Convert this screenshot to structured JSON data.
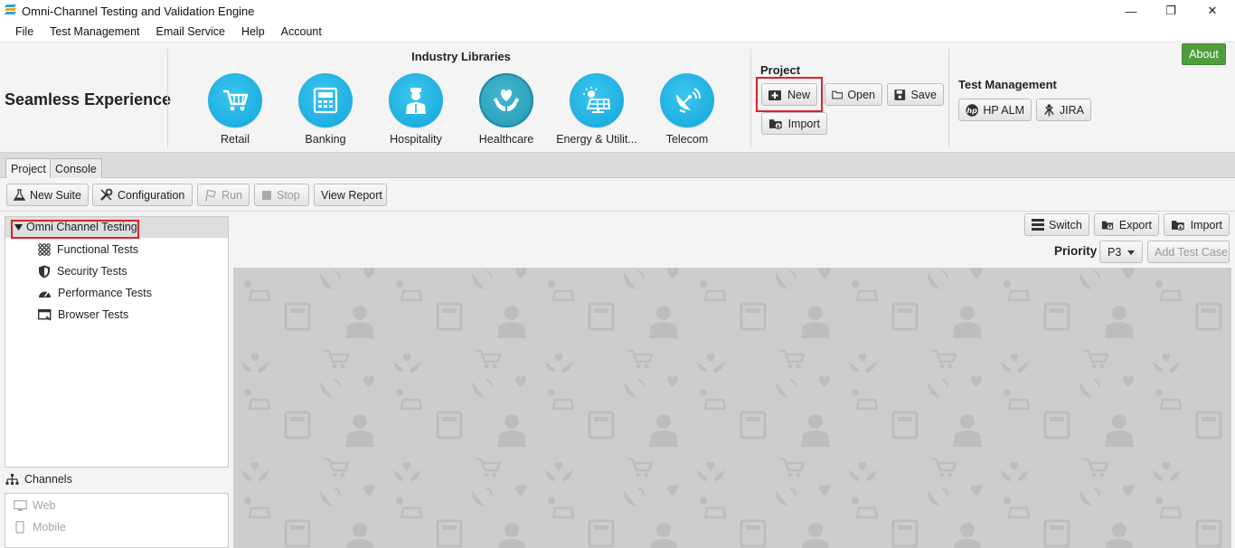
{
  "window": {
    "title": "Omni-Channel Testing and Validation Engine",
    "minimize_glyph": "—",
    "maximize_glyph": "❐",
    "close_glyph": "✕"
  },
  "menu": [
    "File",
    "Test Management",
    "Email Service",
    "Help",
    "Account"
  ],
  "ribbon": {
    "brand": "Seamless Experience",
    "libraries_title": "Industry Libraries",
    "libraries": [
      {
        "label": "Retail",
        "icon": "cart-icon"
      },
      {
        "label": "Banking",
        "icon": "atm-icon"
      },
      {
        "label": "Hospitality",
        "icon": "bellhop-icon"
      },
      {
        "label": "Healthcare",
        "icon": "heart-hands-icon"
      },
      {
        "label": "Energy & Utilit...",
        "icon": "solar-panel-icon"
      },
      {
        "label": "Telecom",
        "icon": "satellite-dish-icon"
      }
    ],
    "project_title": "Project",
    "project_buttons": {
      "new": "New",
      "open": "Open",
      "save": "Save",
      "import": "Import"
    },
    "tm_title": "Test Management",
    "tm_buttons": {
      "hp_alm": "HP ALM",
      "jira": "JIRA"
    },
    "about": "About"
  },
  "tabs": [
    "Project",
    "Console"
  ],
  "toolbar": {
    "new_suite": "New Suite",
    "configuration": "Configuration",
    "run": "Run",
    "stop": "Stop",
    "view_report": "View Report"
  },
  "tree": {
    "root": "Omni Channel Testing",
    "children": [
      "Functional Tests",
      "Security Tests",
      "Performance Tests",
      "Browser Tests"
    ]
  },
  "channels": {
    "title": "Channels",
    "items": [
      "Web",
      "Mobile"
    ]
  },
  "right_panel": {
    "switch": "Switch",
    "export": "Export",
    "import": "Import",
    "priority_label": "Priority",
    "priority_value": "P3",
    "add_test_case": "Add Test Case"
  },
  "colors": {
    "library_blue": "#1aaee3",
    "highlight_red": "#e0202a",
    "about_green": "#4e9e3b"
  }
}
